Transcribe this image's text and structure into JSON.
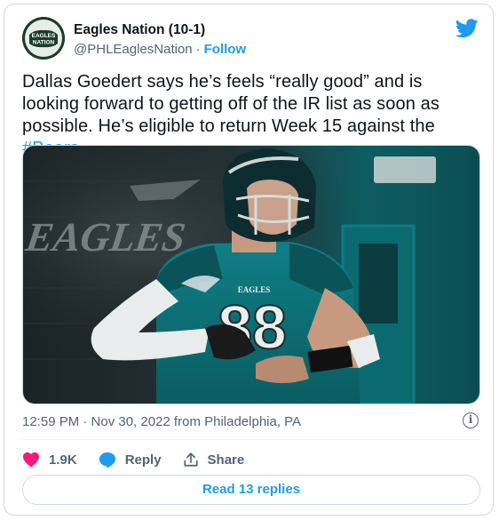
{
  "author": {
    "name": "Eagles Nation (10-1)",
    "handle": "@PHLEaglesNation",
    "separator": "·",
    "follow_label": "Follow",
    "avatar_text_top": "EAGLES",
    "avatar_text_bottom": "NATION"
  },
  "tweet": {
    "text_main": "Dallas Goedert says he’s feels “really good” and is looking forward to getting off of the IR list as soon as possible. He’s eligible to return Week 15 against the ",
    "hashtag": "#Bears",
    "text_end": "."
  },
  "media": {
    "wall_text": "EAGLES",
    "jersey_number": "88",
    "jersey_logo": "EAGLES"
  },
  "meta": {
    "timestamp": "12:59 PM · Nov 30, 2022 from Philadelphia, PA",
    "info_glyph": "i"
  },
  "actions": {
    "likes_count": "1.9K",
    "reply_label": "Reply",
    "share_label": "Share"
  },
  "read_replies_label": "Read 13 replies",
  "colors": {
    "accent": "#1d9bf0",
    "like": "#f91880",
    "text": "#0f1419",
    "secondary": "#536471",
    "eagles_teal": "#005a5e"
  },
  "icons": {
    "brand": "twitter-bird-icon",
    "like": "heart-icon",
    "reply": "reply-bubble-icon",
    "share": "share-upload-icon",
    "info": "info-icon"
  }
}
